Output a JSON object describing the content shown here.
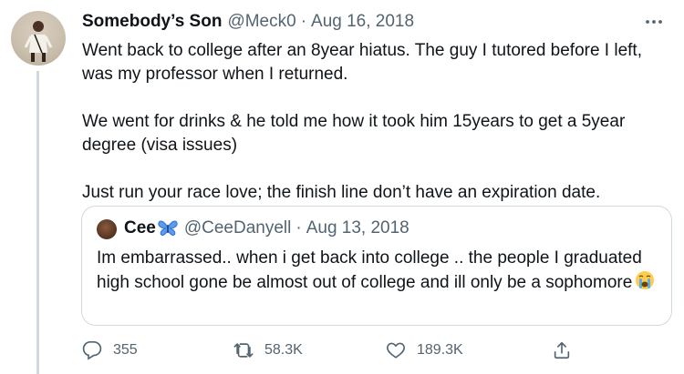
{
  "tweet": {
    "author_name": "Somebody’s Son",
    "author_handle": "@Meck0",
    "separator": "·",
    "date": "Aug 16, 2018",
    "paragraphs": [
      "Went back to college after an 8year hiatus. The guy I tutored before I left, was my professor when I returned.",
      "We went for drinks & he told me how it took him 15years to get a 5year degree (visa issues)",
      "Just run your race love; the finish line don’t have an expiration date."
    ]
  },
  "quoted_tweet": {
    "author_name": "Cee",
    "author_handle": "@CeeDanyell",
    "separator": "·",
    "date": "Aug 13, 2018",
    "text": "Im embarrassed.. when i get back into college .. the people I graduated high school gone be almost out of college and ill only be a sophomore"
  },
  "actions": {
    "replies": "355",
    "retweets": "58.3K",
    "likes": "189.3K"
  },
  "icons": {
    "more": "more-horizontal-icon",
    "reply": "reply-icon",
    "retweet": "retweet-icon",
    "like": "heart-icon",
    "share": "share-icon",
    "name_emoji": "butterfly-emoji",
    "text_emoji": "crying-face-emoji"
  },
  "colors": {
    "text_primary": "#0f1419",
    "text_secondary": "#536471",
    "border": "#cfd9de",
    "butterfly": "#2f6fd6"
  }
}
